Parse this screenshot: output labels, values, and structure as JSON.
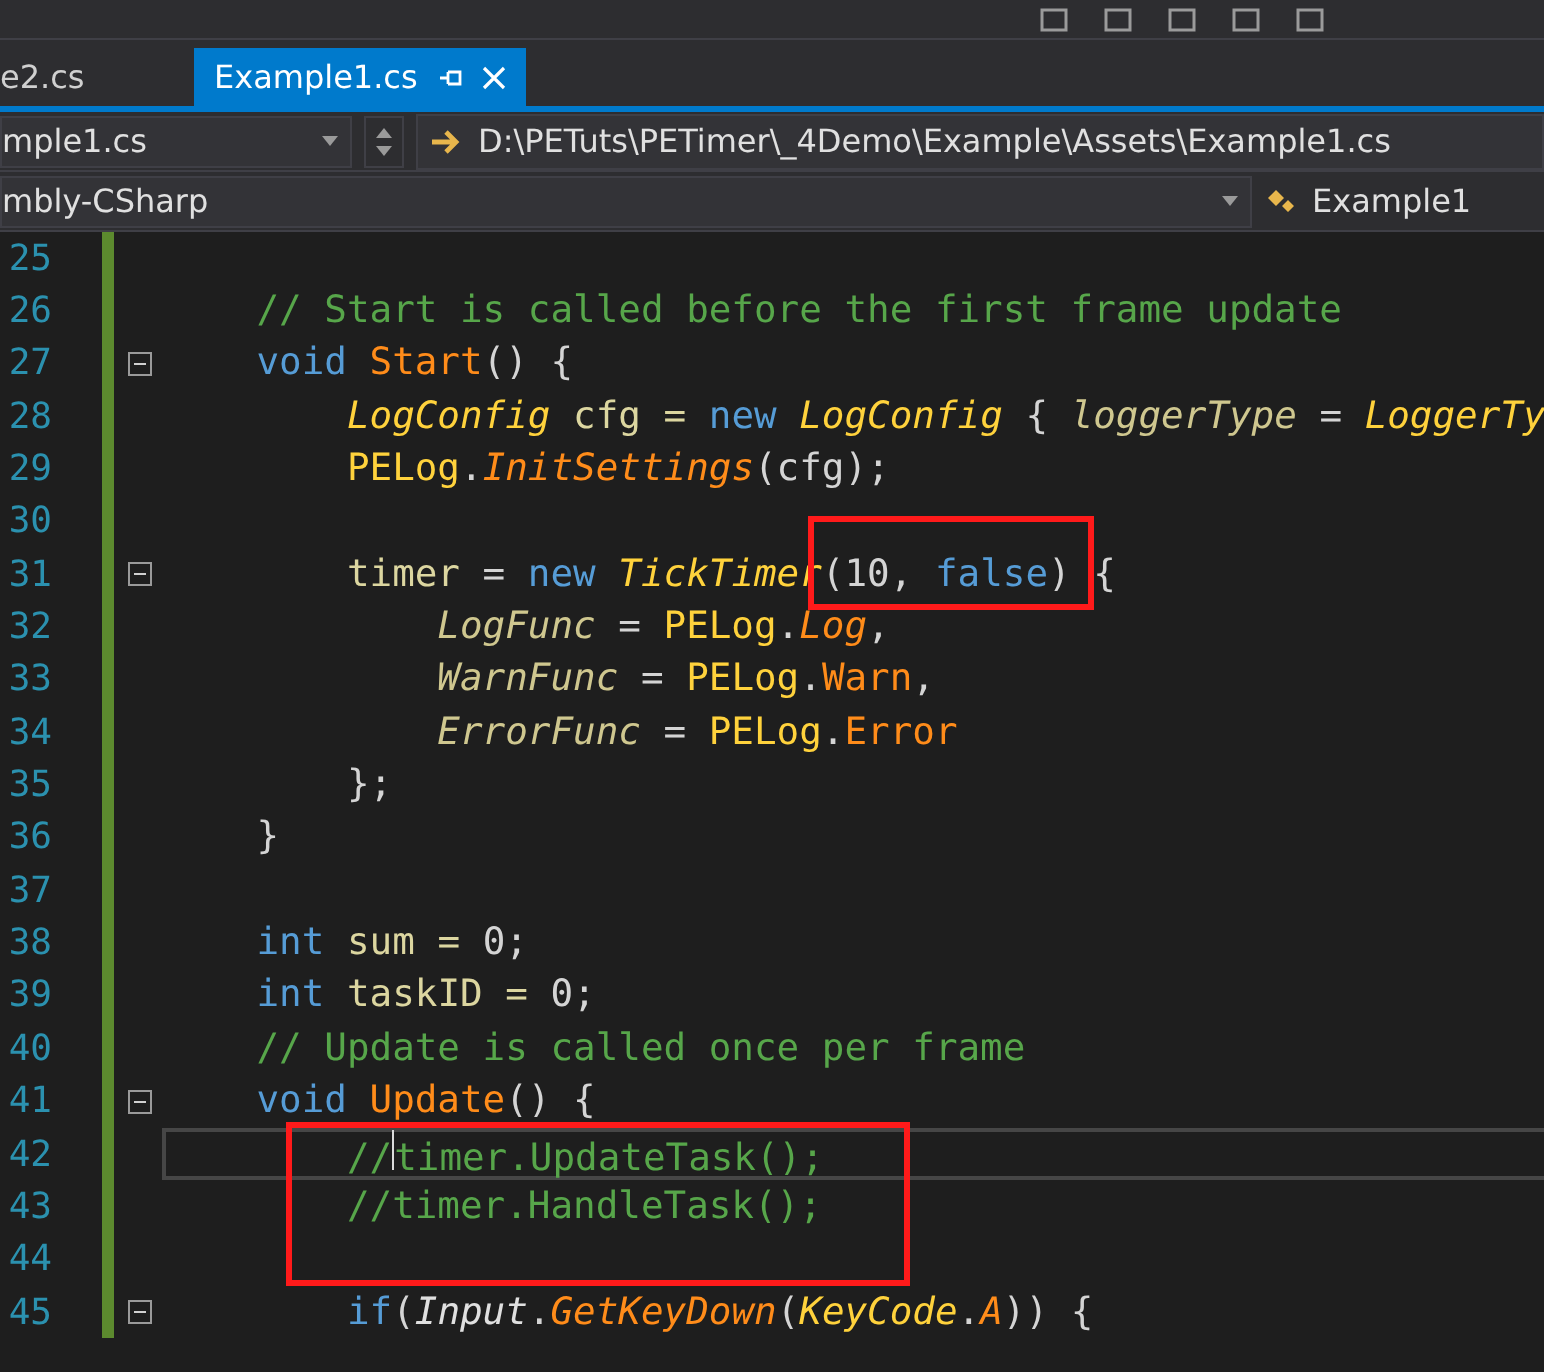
{
  "tabs": [
    {
      "label": "e2.cs",
      "selected": false,
      "pinned": false
    },
    {
      "label": "Example1.cs",
      "selected": true,
      "pinned": true
    }
  ],
  "navigation": {
    "file_dropdown": "mple1.cs",
    "path": "D:\\PETuts\\PETimer\\_4Demo\\Example\\Assets\\Example1.cs",
    "project_dropdown": "mbly-CSharp",
    "class_dropdown": "Example1"
  },
  "editor": {
    "lines": [
      {
        "number": "25",
        "foldable": false,
        "current": false
      },
      {
        "number": "26",
        "foldable": false,
        "current": false,
        "tokens": [
          {
            "text": "    // Start is called before the first frame update",
            "kind": "comment"
          }
        ]
      },
      {
        "number": "27",
        "foldable": true,
        "current": false,
        "tokens": [
          {
            "text": "    void ",
            "kind": "keyword"
          },
          {
            "text": "Start",
            "kind": "method"
          },
          {
            "text": "() {",
            "kind": "punct"
          }
        ]
      },
      {
        "number": "28",
        "foldable": false,
        "current": false,
        "tokens": [
          {
            "text": "        LogConfig",
            "kind": "type"
          },
          {
            "text": " cfg = ",
            "kind": "local"
          },
          {
            "text": "new ",
            "kind": "keyword"
          },
          {
            "text": "LogConfig",
            "kind": "type"
          },
          {
            "text": " { ",
            "kind": "punct"
          },
          {
            "text": "loggerType",
            "kind": "field"
          },
          {
            "text": " = ",
            "kind": "punct"
          },
          {
            "text": "LoggerTy",
            "kind": "type"
          }
        ]
      },
      {
        "number": "29",
        "foldable": false,
        "current": false,
        "tokens": [
          {
            "text": "        PELog",
            "kind": "class"
          },
          {
            "text": ".",
            "kind": "punct"
          },
          {
            "text": "InitSettings",
            "kind": "method_static"
          },
          {
            "text": "(cfg);",
            "kind": "punct"
          }
        ]
      },
      {
        "number": "30",
        "foldable": false,
        "current": false
      },
      {
        "number": "31",
        "foldable": true,
        "current": false,
        "tokens": [
          {
            "text": "        timer",
            "kind": "local"
          },
          {
            "text": " = ",
            "kind": "punct"
          },
          {
            "text": "new ",
            "kind": "keyword"
          },
          {
            "text": "TickTimer",
            "kind": "type"
          },
          {
            "text": "(10, ",
            "kind": "punct"
          },
          {
            "text": "false",
            "kind": "keyword"
          },
          {
            "text": ") {",
            "kind": "punct"
          }
        ]
      },
      {
        "number": "32",
        "foldable": false,
        "current": false,
        "tokens": [
          {
            "text": "            LogFunc",
            "kind": "field"
          },
          {
            "text": " = ",
            "kind": "punct"
          },
          {
            "text": "PELog",
            "kind": "class"
          },
          {
            "text": ".",
            "kind": "punct"
          },
          {
            "text": "Log",
            "kind": "method_static"
          },
          {
            "text": ",",
            "kind": "punct"
          }
        ]
      },
      {
        "number": "33",
        "foldable": false,
        "current": false,
        "tokens": [
          {
            "text": "            WarnFunc",
            "kind": "field"
          },
          {
            "text": " = ",
            "kind": "punct"
          },
          {
            "text": "PELog",
            "kind": "class"
          },
          {
            "text": ".",
            "kind": "punct"
          },
          {
            "text": "Warn",
            "kind": "method"
          },
          {
            "text": ",",
            "kind": "punct"
          }
        ]
      },
      {
        "number": "34",
        "foldable": false,
        "current": false,
        "tokens": [
          {
            "text": "            ErrorFunc",
            "kind": "field"
          },
          {
            "text": " = ",
            "kind": "punct"
          },
          {
            "text": "PELog",
            "kind": "class"
          },
          {
            "text": ".",
            "kind": "punct"
          },
          {
            "text": "Error",
            "kind": "method"
          }
        ]
      },
      {
        "number": "35",
        "foldable": false,
        "current": false,
        "tokens": [
          {
            "text": "        };",
            "kind": "punct"
          }
        ]
      },
      {
        "number": "36",
        "foldable": false,
        "current": false,
        "tokens": [
          {
            "text": "    }",
            "kind": "punct"
          }
        ]
      },
      {
        "number": "37",
        "foldable": false,
        "current": false
      },
      {
        "number": "38",
        "foldable": false,
        "current": false,
        "tokens": [
          {
            "text": "    int",
            "kind": "keyword"
          },
          {
            "text": " sum = ",
            "kind": "local"
          },
          {
            "text": "0;",
            "kind": "punct"
          }
        ]
      },
      {
        "number": "39",
        "foldable": false,
        "current": false,
        "tokens": [
          {
            "text": "    int",
            "kind": "keyword"
          },
          {
            "text": " taskID = ",
            "kind": "local"
          },
          {
            "text": "0;",
            "kind": "punct"
          }
        ]
      },
      {
        "number": "40",
        "foldable": false,
        "current": false,
        "tokens": [
          {
            "text": "    // Update is called once per frame",
            "kind": "comment"
          }
        ]
      },
      {
        "number": "41",
        "foldable": true,
        "current": false,
        "tokens": [
          {
            "text": "    void ",
            "kind": "keyword"
          },
          {
            "text": "Update",
            "kind": "method"
          },
          {
            "text": "() {",
            "kind": "punct"
          }
        ]
      },
      {
        "number": "42",
        "foldable": false,
        "current": true,
        "tokens": [
          {
            "text": "        //",
            "kind": "comment"
          },
          {
            "text": "timer.UpdateTask();",
            "kind": "comment"
          }
        ]
      },
      {
        "number": "43",
        "foldable": false,
        "current": false,
        "tokens": [
          {
            "text": "        //timer.HandleTask();",
            "kind": "comment"
          }
        ]
      },
      {
        "number": "44",
        "foldable": false,
        "current": false
      },
      {
        "number": "45",
        "foldable": true,
        "current": false,
        "tokens": [
          {
            "text": "        if",
            "kind": "keyword"
          },
          {
            "text": "(",
            "kind": "punct"
          },
          {
            "text": "Input",
            "kind": "static"
          },
          {
            "text": ".",
            "kind": "punct"
          },
          {
            "text": "GetKeyDown",
            "kind": "method_static"
          },
          {
            "text": "(",
            "kind": "punct"
          },
          {
            "text": "KeyCode",
            "kind": "type"
          },
          {
            "text": ".",
            "kind": "punct"
          },
          {
            "text": "A",
            "kind": "method_static"
          },
          {
            "text": ")) {",
            "kind": "punct"
          }
        ]
      }
    ]
  }
}
